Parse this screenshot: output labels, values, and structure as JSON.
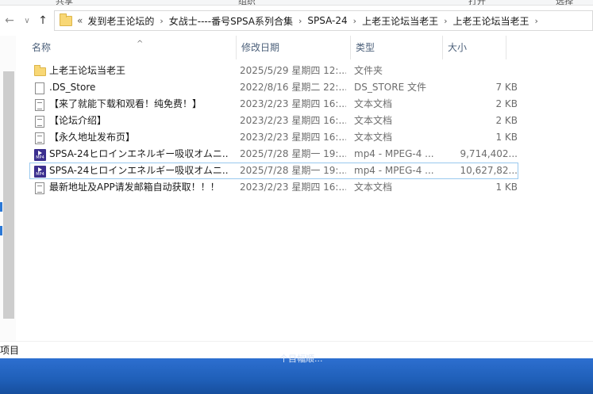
{
  "ribbon": {
    "tabs": [
      "共享",
      "组织",
      "打开",
      "选择"
    ]
  },
  "navbar": {
    "back_icon": "arrow-left-icon",
    "forward_icon": "arrow-right-icon",
    "recent_icon": "chevron-down-icon",
    "up_icon": "arrow-up-icon",
    "overflow": "«",
    "breadcrumb": [
      "发到老王论坛的",
      "女战士----番号SPSA系列合集",
      "SPSA-24",
      "上老王论坛当老王",
      "上老王论坛当老王"
    ]
  },
  "columns": {
    "name": "名称",
    "date": "修改日期",
    "type": "类型",
    "size": "大小"
  },
  "files": [
    {
      "icon": "folder-icon",
      "name": "上老王论坛当老王",
      "date": "2025/5/29 星期四 12:...",
      "type": "文件夹",
      "size": ""
    },
    {
      "icon": "file-icon",
      "name": ".DS_Store",
      "date": "2022/8/16 星期二 22:...",
      "type": "DS_STORE 文件",
      "size": "7 KB"
    },
    {
      "icon": "text-file-icon",
      "name": "【来了就能下载和观看！纯免费！】",
      "date": "2023/2/23 星期四 16:...",
      "type": "文本文档",
      "size": "2 KB"
    },
    {
      "icon": "text-file-icon",
      "name": "【论坛介绍】",
      "date": "2023/2/23 星期四 16:...",
      "type": "文本文档",
      "size": "2 KB"
    },
    {
      "icon": "text-file-icon",
      "name": "【永久地址发布页】",
      "date": "2023/2/23 星期四 16:...",
      "type": "文本文档",
      "size": "1 KB"
    },
    {
      "icon": "video-file-icon",
      "name": "SPSA-24ヒロインエネルギー吸収オムニ...",
      "date": "2025/7/28 星期一 19:...",
      "type": "mp4 - MPEG-4 ...",
      "size": "9,714,402..."
    },
    {
      "icon": "video-file-icon",
      "name": "SPSA-24ヒロインエネルギー吸収オムニ...",
      "date": "2025/7/28 星期一 19:...",
      "type": "mp4 - MPEG-4 ...",
      "size": "10,627,82..."
    },
    {
      "icon": "text-file-icon",
      "name": "最新地址及APP请发邮箱自动获取！！！",
      "date": "2023/2/23 星期四 16:...",
      "type": "文本文档",
      "size": "1 KB"
    }
  ],
  "video_icon_label": "MP4",
  "statusbar": {
    "text": "项目"
  },
  "taskbar": {
    "hint": "个目幅顺..."
  }
}
